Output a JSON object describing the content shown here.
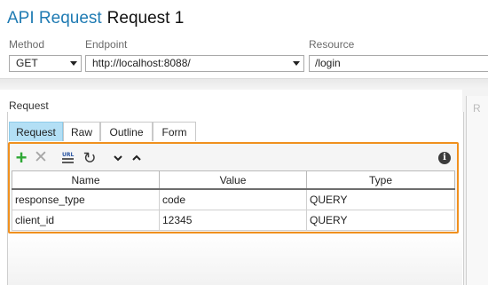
{
  "header": {
    "title_prefix": "API Request",
    "title_name": "Request 1"
  },
  "fields": {
    "method_label": "Method",
    "method_value": "GET",
    "endpoint_label": "Endpoint",
    "endpoint_value": "http://localhost:8088/",
    "resource_label": "Resource",
    "resource_value": "/login"
  },
  "request_panel": {
    "title": "Request",
    "tabs": [
      {
        "label": "Request",
        "active": true
      },
      {
        "label": "Raw",
        "active": false
      },
      {
        "label": "Outline",
        "active": false
      },
      {
        "label": "Form",
        "active": false
      }
    ],
    "toolbar": {
      "add_icon": "plus-icon",
      "remove_icon": "cross-icon",
      "url_params_icon": "url-params-icon",
      "refresh_icon": "refresh-icon",
      "move_down_icon": "chevron-down-icon",
      "move_up_icon": "chevron-up-icon",
      "info_icon": "info-icon"
    },
    "grid": {
      "columns": [
        "Name",
        "Value",
        "Type"
      ],
      "rows": [
        [
          "response_type",
          "code",
          "QUERY"
        ],
        [
          "client_id",
          "12345",
          "QUERY"
        ]
      ]
    }
  },
  "colors": {
    "accent_title": "#1f7bb3",
    "highlight_border": "#f0901e",
    "active_tab": "#b3dff5",
    "add_green": "#2fa836"
  }
}
